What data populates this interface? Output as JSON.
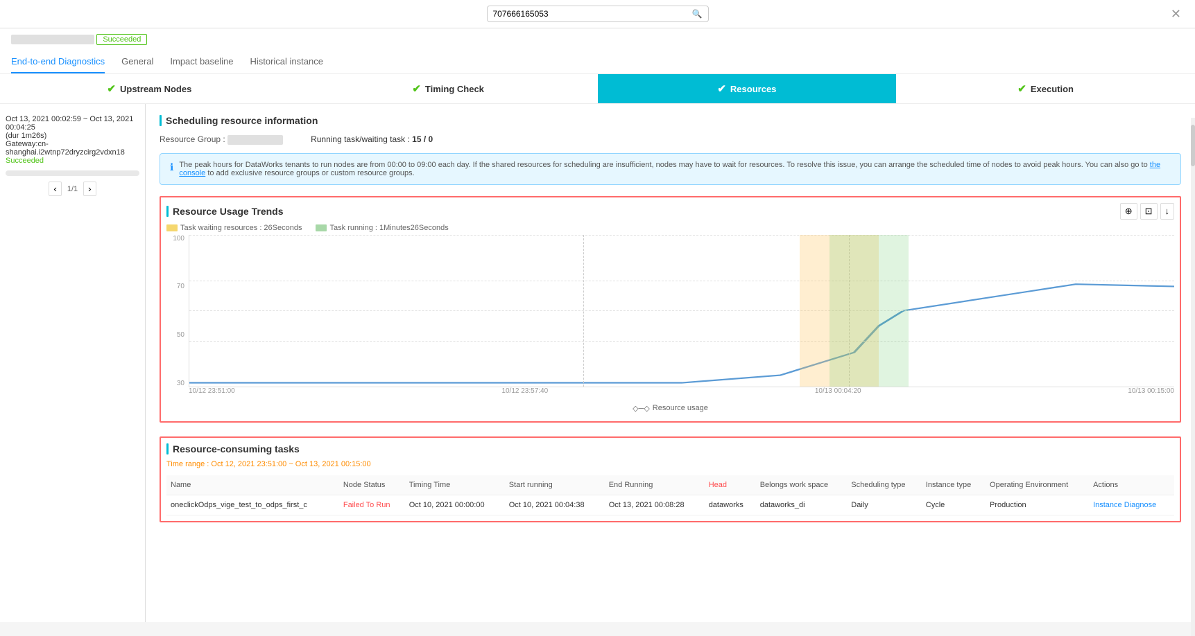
{
  "topbar": {
    "search_value": "707666165053",
    "search_placeholder": "707666165053"
  },
  "header": {
    "status": "Succeeded",
    "tabs": [
      {
        "label": "End-to-end Diagnostics",
        "active": true
      },
      {
        "label": "General",
        "active": false
      },
      {
        "label": "Impact baseline",
        "active": false
      },
      {
        "label": "Historical instance",
        "active": false
      }
    ]
  },
  "wizard": {
    "steps": [
      {
        "label": "Upstream Nodes",
        "state": "done"
      },
      {
        "label": "Timing Check",
        "state": "done"
      },
      {
        "label": "Resources",
        "state": "active"
      },
      {
        "label": "Execution",
        "state": "done"
      }
    ]
  },
  "sidebar": {
    "item": {
      "date_range": "Oct 13, 2021 00:02:59 ~ Oct 13, 2021 00:04:25",
      "duration": "(dur 1m26s)",
      "gateway": "Gateway:cn-shanghai.i2wtnp72dryzcirg2vdxn18",
      "status": "Succeeded"
    },
    "pagination": "1/1"
  },
  "scheduling_info": {
    "title": "Scheduling resource information",
    "resource_group_label": "Resource Group :",
    "running_task_label": "Running task/waiting task :",
    "running_task_value": "15 / 0",
    "info_text": "The peak hours for DataWorks tenants to run nodes are from 00:00 to 09:00 each day. If the shared resources for scheduling are insufficient, nodes may have to wait for resources. To resolve this issue, you can arrange the scheduled time of nodes to avoid peak hours. You can also go to ",
    "console_link": "the console",
    "info_text2": " to add exclusive resource groups or custom resource groups."
  },
  "chart": {
    "title": "Resource Usage Trends",
    "legend": {
      "waiting": "Task waiting resources : 26Seconds",
      "running": "Task running : 1Minutes26Seconds"
    },
    "y_axis": [
      "100",
      "70",
      "50",
      "30"
    ],
    "x_axis": [
      "10/12 23:51:00",
      "10/12 23:57:40",
      "10/13 00:04:20",
      "10/13 00:15:00"
    ],
    "bottom_label": "Resource usage",
    "actions": [
      "⊕",
      "⊡",
      "↓"
    ]
  },
  "resource_consuming": {
    "title": "Resource-consuming tasks",
    "time_range_label": "Time range :",
    "time_range_value": "Oct 12, 2021 23:51:00 ~ Oct 13, 2021 00:15:00",
    "table": {
      "headers": [
        "Name",
        "Node Status",
        "Timing Time",
        "Start running",
        "End Running",
        "Head",
        "Belongs work space",
        "Scheduling type",
        "Instance type",
        "Operating Environment",
        "Actions"
      ],
      "rows": [
        {
          "name": "oneclickOdps_vige_test_to_odps_first_c",
          "status": "Failed To Run",
          "timing_time": "Oct 10, 2021 00:00:00",
          "start_running": "Oct 10, 2021 00:04:38",
          "end_running": "Oct 13, 2021 00:08:28",
          "head": "dataworks",
          "belongs_workspace": "dataworks_di",
          "scheduling_type": "Daily",
          "instance_type": "Cycle",
          "operating_env": "Production",
          "action": "Instance Diagnose"
        }
      ]
    }
  }
}
